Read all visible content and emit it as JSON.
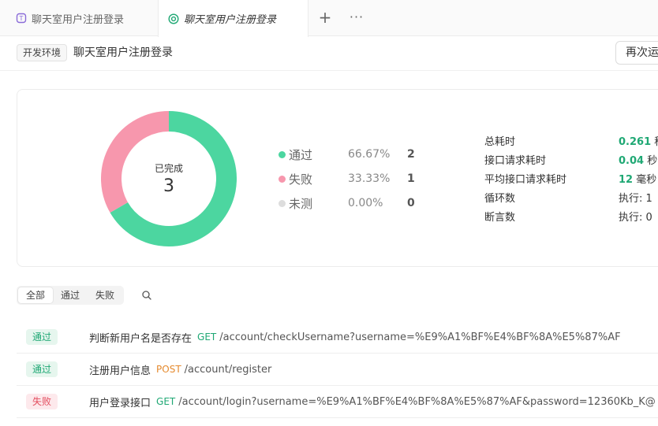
{
  "tabs": [
    {
      "label": "聊天室用户注册登录",
      "icon": "testsuite-icon"
    },
    {
      "label": "聊天室用户注册登录",
      "icon": "run-report-icon",
      "active": true
    }
  ],
  "tab_add": "+",
  "tab_more": "···",
  "header": {
    "env": "开发环境",
    "title": "聊天室用户注册登录",
    "rerun_label": "再次运"
  },
  "summary": {
    "center_label": "已完成",
    "center_count": "3",
    "pass_color": "#4cd6a0",
    "fail_color": "#f797ad",
    "untested_color": "#dddddd",
    "legend": [
      {
        "name": "通过",
        "pct": "66.67%",
        "count": "2"
      },
      {
        "name": "失败",
        "pct": "33.33%",
        "count": "1"
      },
      {
        "name": "未测",
        "pct": "0.00%",
        "count": "0"
      }
    ],
    "stats": [
      {
        "label": "总耗时",
        "value": "0.261",
        "unit": " 秒"
      },
      {
        "label": "接口请求耗时",
        "value": "0.04",
        "unit": " 秒"
      },
      {
        "label": "平均接口请求耗时",
        "value": "12",
        "unit": " 毫秒"
      },
      {
        "label": "循环数",
        "value": "",
        "unit": "执行: 1"
      },
      {
        "label": "断言数",
        "value": "",
        "unit": "执行: 0"
      }
    ]
  },
  "filter": {
    "options": [
      "全部",
      "通过",
      "失败"
    ]
  },
  "results": [
    {
      "status": "通过",
      "name": "判断新用户名是否存在",
      "method": "GET",
      "path": "/account/checkUsername?username=%E9%A1%BF%E4%BF%8A%E5%87%AF"
    },
    {
      "status": "通过",
      "name": "注册用户信息",
      "method": "POST",
      "path": "/account/register"
    },
    {
      "status": "失败",
      "name": "用户登录接口",
      "method": "GET",
      "path": "/account/login?username=%E9%A1%BF%E4%BF%8A%E5%87%AF&password=12360Kb_K@"
    }
  ]
}
